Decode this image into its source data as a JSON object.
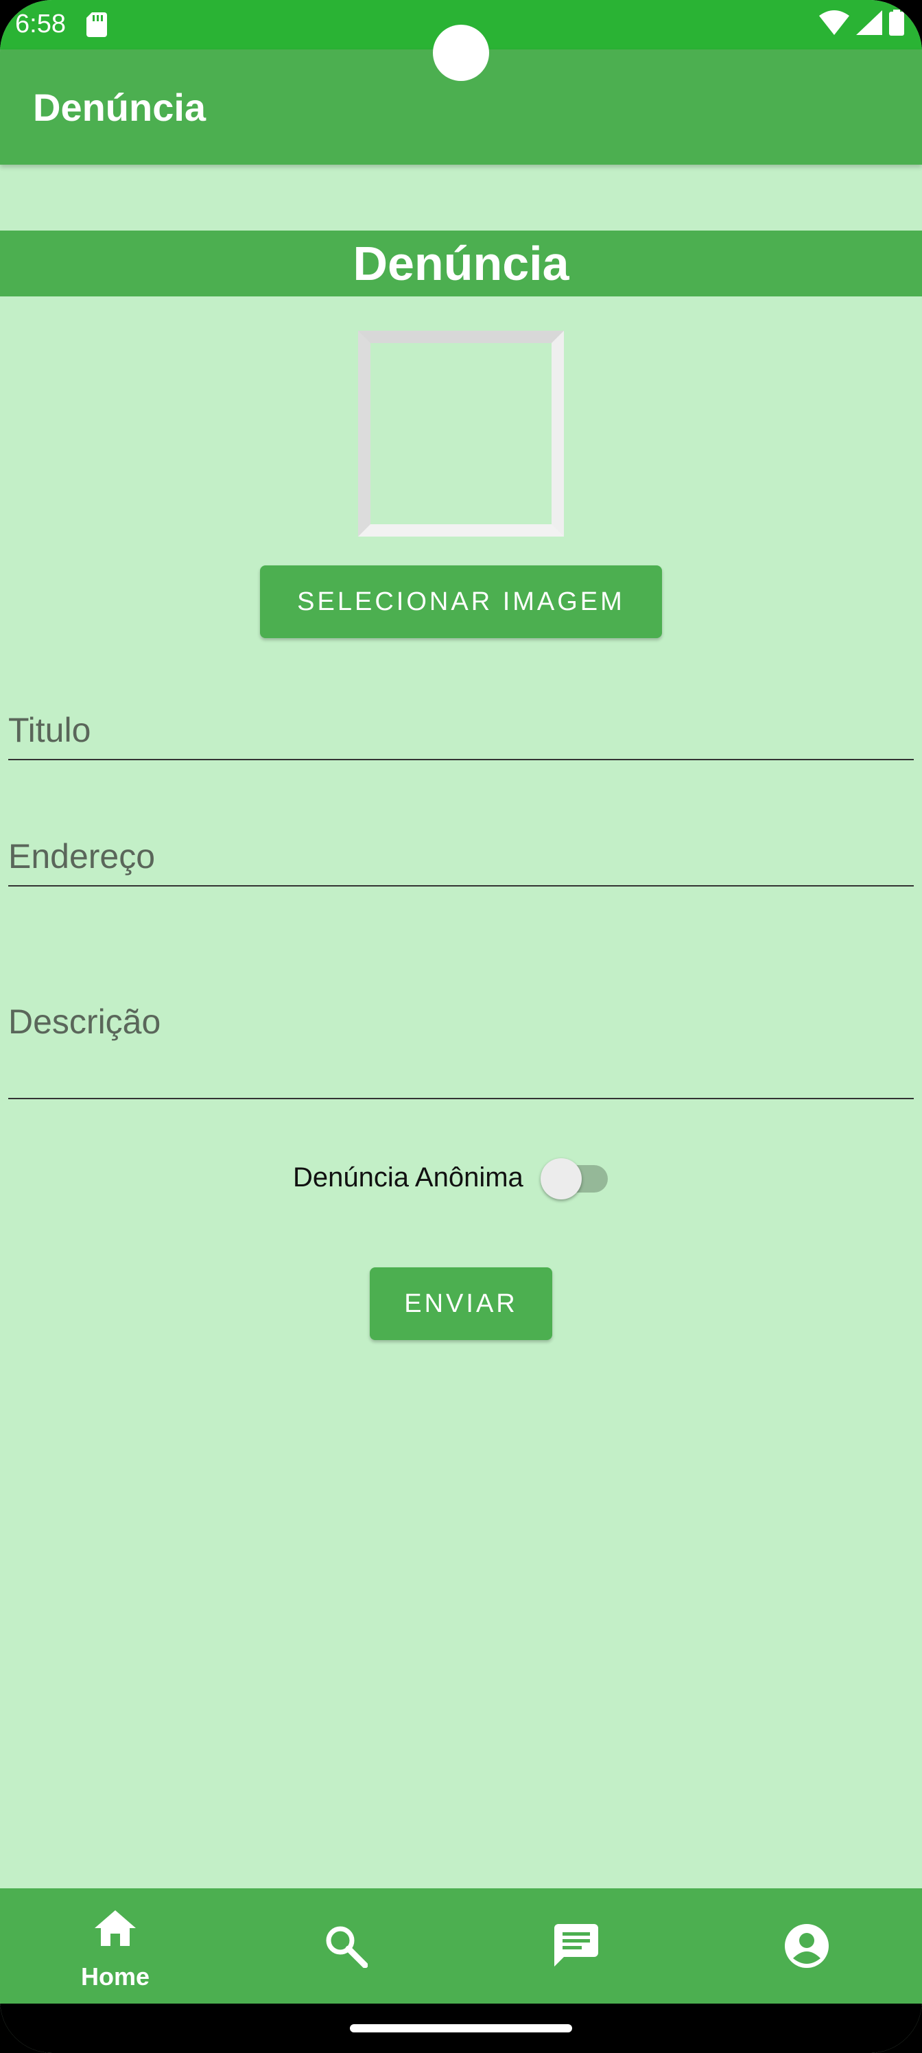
{
  "status_bar": {
    "time": "6:58",
    "icons": [
      "sd-card-icon",
      "wifi-icon",
      "signal-icon",
      "battery-icon"
    ]
  },
  "app_bar": {
    "title": "Denúncia"
  },
  "form": {
    "header": "Denúncia",
    "select_image_label": "SELECIONAR IMAGEM",
    "title_placeholder": "Titulo",
    "address_placeholder": "Endereço",
    "description_placeholder": "Descrição",
    "anonymous_label": "Denúncia Anônima",
    "anonymous_checked": false,
    "send_label": "ENVIAR"
  },
  "bottom_nav": {
    "items": [
      {
        "icon": "home-icon",
        "label": "Home",
        "active": true
      },
      {
        "icon": "search-icon",
        "label": ""
      },
      {
        "icon": "chat-icon",
        "label": ""
      },
      {
        "icon": "account-icon",
        "label": ""
      }
    ]
  },
  "colors": {
    "primary": "#4caf50",
    "status_bar": "#2ab334",
    "background": "#c3efc7"
  }
}
